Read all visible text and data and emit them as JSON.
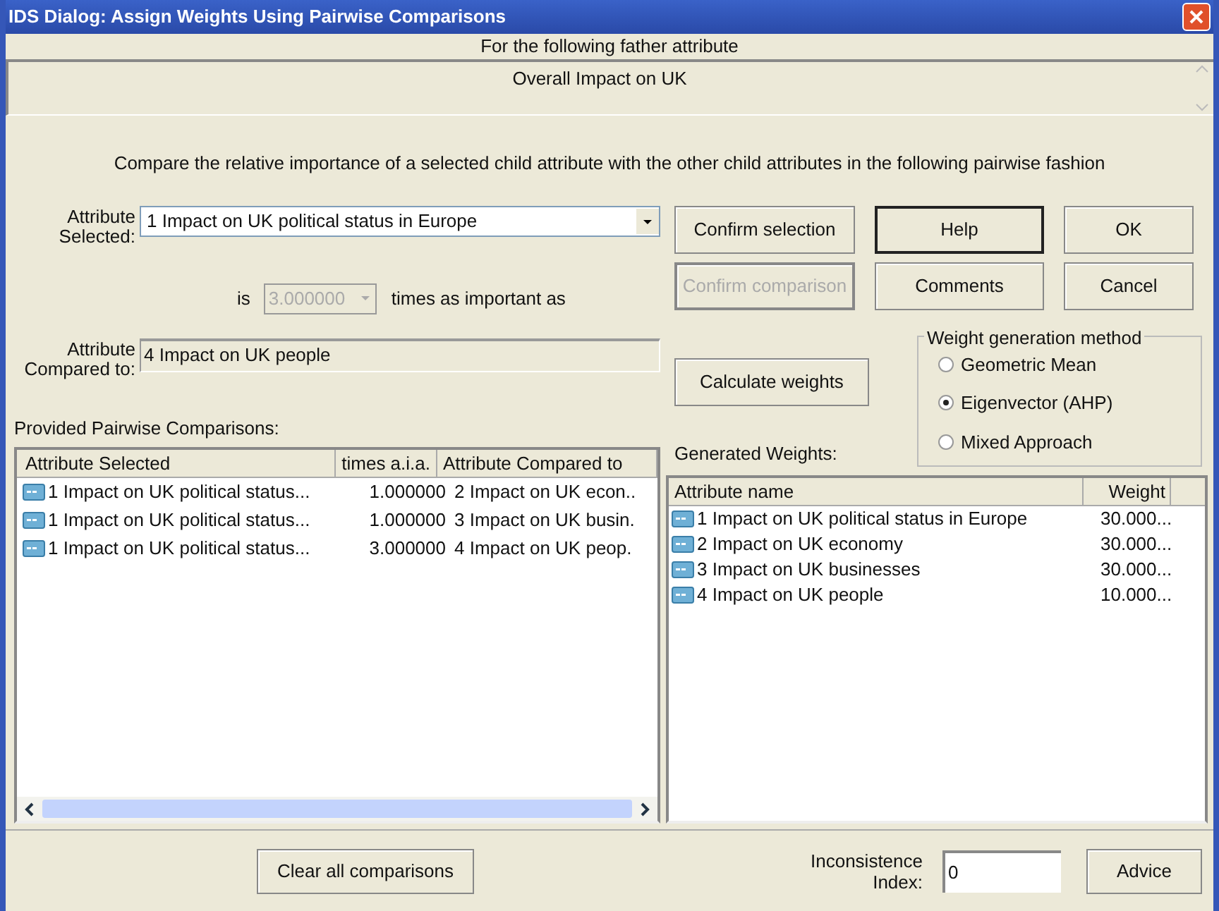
{
  "window": {
    "title": "IDS Dialog: Assign Weights Using Pairwise Comparisons"
  },
  "father_attribute": {
    "heading": "For the following father attribute",
    "value": "Overall Impact on UK"
  },
  "instruction": "Compare the relative importance of a selected child attribute with the other child attributes in the following pairwise fashion",
  "attribute_selected": {
    "label": "Attribute Selected:",
    "value": "1 Impact on UK political status in Europe"
  },
  "ratio": {
    "prefix": "is",
    "value": "3.000000",
    "disabled": true,
    "suffix": "times as important as"
  },
  "attribute_compared": {
    "label": "Attribute Compared to:",
    "value": "4 Impact on UK people"
  },
  "buttons": [
    {
      "label": "Confirm selection",
      "disabled": false,
      "default": false
    },
    {
      "label": "Help",
      "disabled": false,
      "default": true
    },
    {
      "label": "OK",
      "disabled": false,
      "default": false
    },
    {
      "label": "Confirm comparison",
      "disabled": true,
      "default": false
    },
    {
      "label": "Comments",
      "disabled": false,
      "default": false
    },
    {
      "label": "Cancel",
      "disabled": false,
      "default": false
    },
    {
      "label": "Calculate weights",
      "disabled": false,
      "default": false
    }
  ],
  "weight_method": {
    "title": "Weight generation method",
    "options": [
      {
        "label": "Geometric Mean",
        "selected": false
      },
      {
        "label": "Eigenvector (AHP)",
        "selected": true
      },
      {
        "label": "Mixed Approach",
        "selected": false
      }
    ]
  },
  "comparisons": {
    "title": "Provided Pairwise Comparisons:",
    "columns": [
      "Attribute Selected",
      "times a.i.a.",
      "Attribute Compared to"
    ],
    "rows": [
      [
        "1 Impact on UK political status...",
        "1.000000",
        "2 Impact on UK econ.."
      ],
      [
        "1 Impact on UK political status...",
        "1.000000",
        "3 Impact on UK busin."
      ],
      [
        "1 Impact on UK political status...",
        "3.000000",
        "4 Impact on UK peop."
      ]
    ]
  },
  "generated_weights": {
    "title": "Generated Weights:",
    "columns": [
      "Attribute name",
      "Weight"
    ],
    "rows": [
      [
        "1 Impact on UK political status in Europe",
        "30.000..."
      ],
      [
        "2 Impact on UK economy",
        "30.000..."
      ],
      [
        "3 Impact on UK businesses",
        "30.000..."
      ],
      [
        "4 Impact on UK people",
        "10.000..."
      ]
    ]
  },
  "clear_button": "Clear all comparisons",
  "inconsistence": {
    "label": "Inconsistence Index:",
    "value": "0"
  },
  "advice_button": "Advice"
}
